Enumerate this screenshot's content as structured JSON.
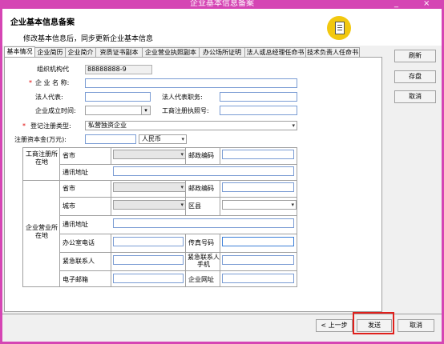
{
  "window": {
    "title": "企业基本信息备案",
    "minimize": "_",
    "close": "×"
  },
  "header": {
    "title": "企业基本信息备案",
    "subtitle": "修改基本信息后，同步更新企业基本信息",
    "icon": "document-icon"
  },
  "tabs": [
    "基本情况",
    "企业简历",
    "企业简介",
    "资质证书副本",
    "企业营业执照副本",
    "办公场所证明",
    "法人或总经理任命书",
    "技术负责人任命书"
  ],
  "form": {
    "org_code_label": "组织机构代",
    "org_code_value": "88888888-9",
    "name_label": "企 业 名 称:",
    "legal_rep_label": "法人代表:",
    "legal_title_label": "法人代表职务:",
    "founded_label": "企业成立时间:",
    "biz_license_label": "工商注册执照号:",
    "reg_type_label": "登记注册类型:",
    "reg_type_value": "私营独资企业",
    "capital_label": "注册资本金(万元):",
    "currency_value": "人民币",
    "reg_section_label": "工商注册所在地",
    "province_label": "省市",
    "postcode_label": "邮政编码",
    "address_label": "通讯地址",
    "biz_section_label": "企业营业所在地",
    "city_label": "城市",
    "district_label": "区县",
    "phone_label": "办公室电话",
    "fax_label": "传真号码",
    "contact_label": "紧急联系人",
    "contact_phone_label": "紧急联系人手机",
    "email_label": "电子邮箱",
    "website_label": "企业网址"
  },
  "side_buttons": {
    "refresh": "刷新",
    "save": "存盘",
    "cancel": "取消"
  },
  "bottom_buttons": {
    "prev": "< 上一步",
    "send": "发送",
    "cancel": "取消"
  }
}
